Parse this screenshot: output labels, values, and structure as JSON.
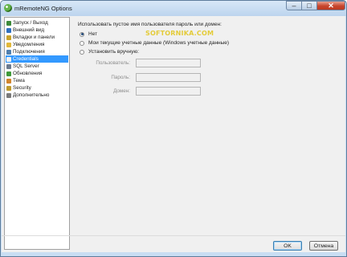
{
  "window": {
    "title": "mRemoteNG Options"
  },
  "sidebar": {
    "items": [
      {
        "label": "Запуск / Выход",
        "icon": "startup-icon",
        "color": "#3d8a3a"
      },
      {
        "label": "Внешний вид",
        "icon": "appearance-icon",
        "color": "#2f6fbf"
      },
      {
        "label": "Вкладки и панели",
        "icon": "tabs-icon",
        "color": "#c9a32a"
      },
      {
        "label": "Уведомления",
        "icon": "notifications-icon",
        "color": "#e2b83a"
      },
      {
        "label": "Подключения",
        "icon": "connections-icon",
        "color": "#4f7fae"
      },
      {
        "label": "Credentials",
        "icon": "credentials-icon",
        "color": "#f2f2f2"
      },
      {
        "label": "SQL Server",
        "icon": "database-icon",
        "color": "#6b7a8e"
      },
      {
        "label": "Обновления",
        "icon": "updates-icon",
        "color": "#3f9a3a"
      },
      {
        "label": "Тема",
        "icon": "theme-icon",
        "color": "#d1842c"
      },
      {
        "label": "Security",
        "icon": "security-icon",
        "color": "#bf9b2d"
      },
      {
        "label": "Дополнительно",
        "icon": "advanced-icon",
        "color": "#7a7a7a"
      }
    ],
    "selected_index": 5
  },
  "credentials": {
    "heading": "Использовать пустое имя пользователя пароль или домен:",
    "options": [
      {
        "label": "Нет",
        "checked": true
      },
      {
        "label": "Мои текущие учетные данные (Windows учетные данные)",
        "checked": false
      },
      {
        "label": "Установить вручную:",
        "checked": false
      }
    ],
    "fields": [
      {
        "label": "Пользователь:",
        "value": ""
      },
      {
        "label": "Пароль:",
        "value": ""
      },
      {
        "label": "Домен:",
        "value": ""
      }
    ]
  },
  "watermark": "SOFTORNIKA.COM",
  "footer": {
    "ok_label": "OK",
    "cancel_label": "Отмена"
  }
}
